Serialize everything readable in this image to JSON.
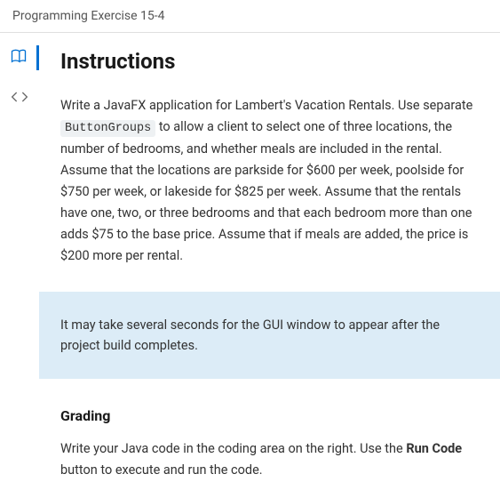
{
  "header": {
    "title": "Programming Exercise 15-4"
  },
  "content": {
    "heading": "Instructions",
    "para1_a": "Write a JavaFX application for Lambert's Vacation Rentals. Use separate ",
    "code_token": "ButtonGroups",
    "para1_b": " to allow a client to select one of three locations, the number of bedrooms, and whether meals are included in the rental. Assume that the locations are parkside for $600 per week, poolside for $750 per week, or lakeside for $825 per week. Assume that the rentals have one, two, or three bedrooms and that each bedroom more than one adds $75 to the base price. Assume that if meals are added, the price is $200 more per rental.",
    "info_note": "It may take several seconds for the GUI window to appear after the project build completes.",
    "grading_heading": "Grading",
    "grading_a": "Write your Java code in the coding area on the right. Use the ",
    "grading_bold": "Run Code",
    "grading_b": " button to execute and run the code."
  }
}
